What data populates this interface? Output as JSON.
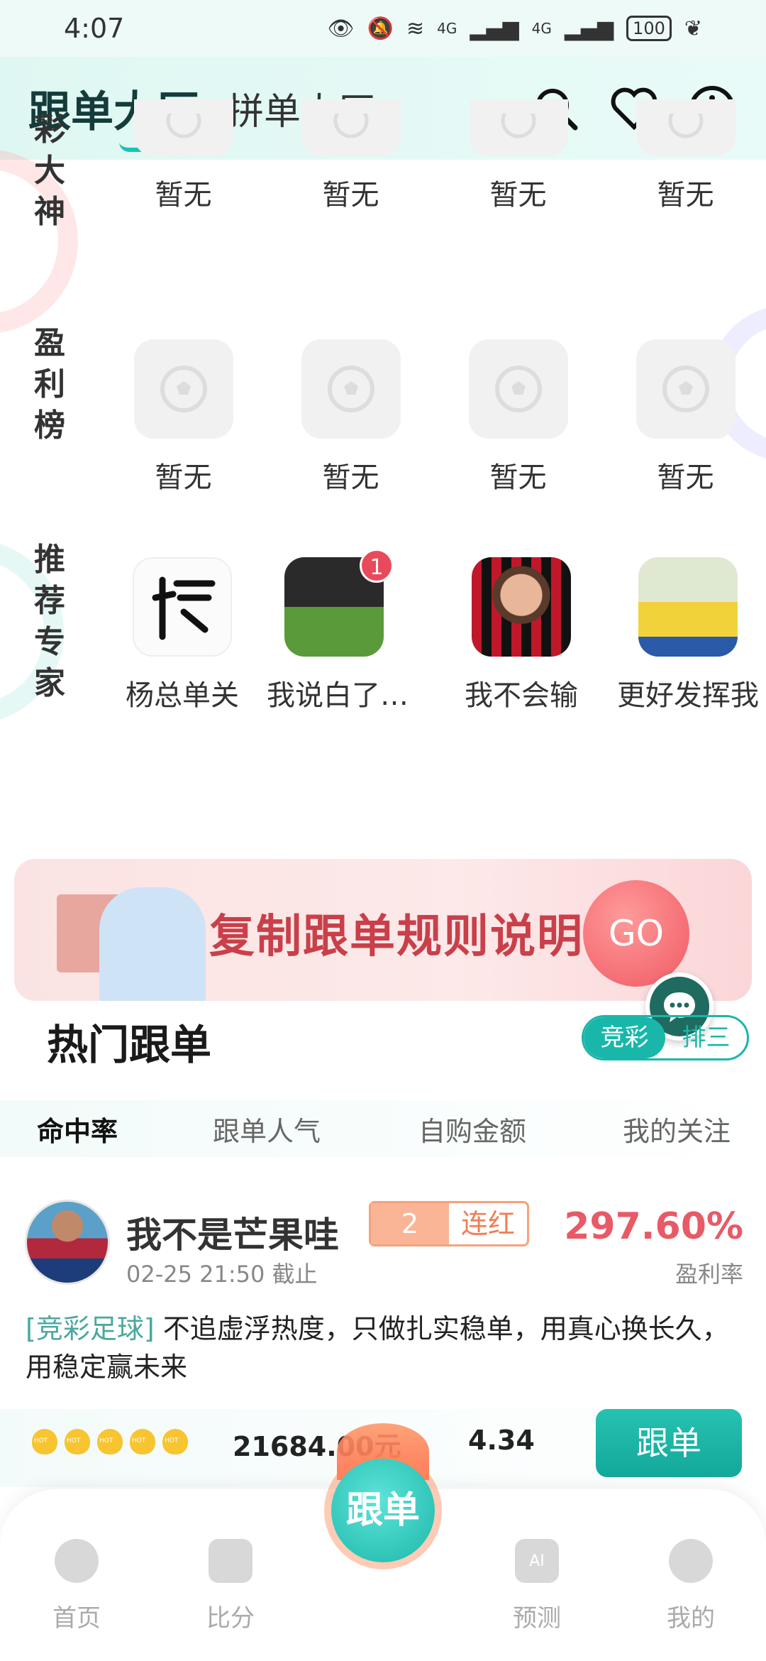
{
  "status_bar": {
    "time": "4:07",
    "net1": "4G",
    "net2": "4G",
    "battery": "100"
  },
  "header": {
    "tab_main": "跟单大厅",
    "tab_sub": "拼单大厅"
  },
  "sections": {
    "great_gods": {
      "label": "彩大神",
      "slots": [
        "暂无",
        "暂无",
        "暂无",
        "暂无"
      ]
    },
    "profit_rank": {
      "label": "盈利榜",
      "slots": [
        "暂无",
        "暂无",
        "暂无",
        "暂无"
      ]
    },
    "recommended": {
      "label": "推荐专家",
      "experts": [
        {
          "name": "杨总单关",
          "badge": ""
        },
        {
          "name": "我说白了…",
          "badge": "1"
        },
        {
          "name": "我不会输",
          "badge": ""
        },
        {
          "name": "更好发挥我",
          "badge": ""
        }
      ]
    }
  },
  "banner": {
    "text": "复制跟单规则说明",
    "go": "GO"
  },
  "hot": {
    "title": "热门跟单",
    "toggle": [
      "竞彩",
      "排三"
    ],
    "tabs": [
      "命中率",
      "跟单人气",
      "自购金额",
      "我的关注"
    ]
  },
  "card": {
    "user": "我不是芒果哇",
    "streak_num": "2",
    "streak_text": "连红",
    "deadline": "02-25 21:50 截止",
    "rate": "297.60%",
    "rate_label": "盈利率",
    "tag": "[竞彩足球]",
    "desc": " 不追虚浮热度，只做扎实稳单，用真心换长久，用稳定赢未来",
    "amount": "21684.00元",
    "odds": "4.34",
    "follow": "跟单"
  },
  "bottom_nav": {
    "items": [
      "首页",
      "比分",
      "预测",
      "我的"
    ],
    "center": "跟单"
  },
  "colors": {
    "accent": "#19b7aa",
    "rate": "#e85a66",
    "banner_text": "#c9404a"
  }
}
